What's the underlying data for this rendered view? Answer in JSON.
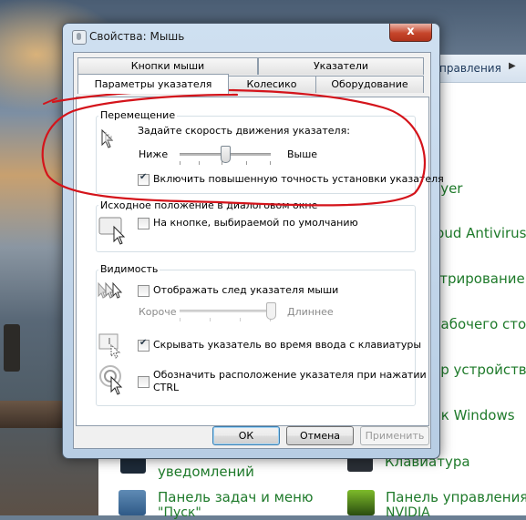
{
  "dialog": {
    "title": "Свойства: Мышь",
    "close_glyph": "x",
    "tabs_row1": [
      "Кнопки мыши",
      "Указатели"
    ],
    "tabs_row2": [
      "Параметры указателя",
      "Колесико",
      "Оборудование"
    ],
    "active_tab": "Параметры указателя",
    "motion": {
      "group_label": "Перемещение",
      "speed_prompt": "Задайте скорость движения указателя:",
      "slow_label": "Ниже",
      "fast_label": "Выше",
      "speed_value_fraction": 0.5,
      "precision_label": "Включить повышенную точность установки указателя",
      "precision_checked": true
    },
    "snap_to": {
      "group_label": "Исходное положение в диалоговом окне",
      "snap_label": "На кнопке, выбираемой по умолчанию",
      "snap_checked": false
    },
    "visibility": {
      "group_label": "Видимость",
      "trails_label": "Отображать след указателя мыши",
      "trails_checked": false,
      "short_label": "Короче",
      "long_label": "Длиннее",
      "trails_value_fraction": 1.0,
      "hide_label": "Скрывать указатель во время ввода с клавиатуры",
      "hide_checked": true,
      "ctrl_label_line1": "Обозначить расположение указателя при нажатии",
      "ctrl_label_line2": "CTRL",
      "ctrl_checked": false
    },
    "buttons": {
      "ok": "ОК",
      "cancel": "Отмена",
      "apply": "Применить"
    }
  },
  "background": {
    "breadcrumb": "правления",
    "breadcrumb_arrow": "▶",
    "items": [
      "ayer",
      "loud Antivirus",
      "стрирование",
      "рабочего сто",
      "ер устройств",
      "ик Windows"
    ],
    "bottom_items": [
      "уведомлений",
      "Клавиатура",
      "Панель задач и меню",
      "Панель управления",
      "\"Пуск\"",
      "NVIDIA"
    ]
  },
  "colors": {
    "annotation_ink": "#d4141b",
    "link_green": "#1e7a2a"
  }
}
